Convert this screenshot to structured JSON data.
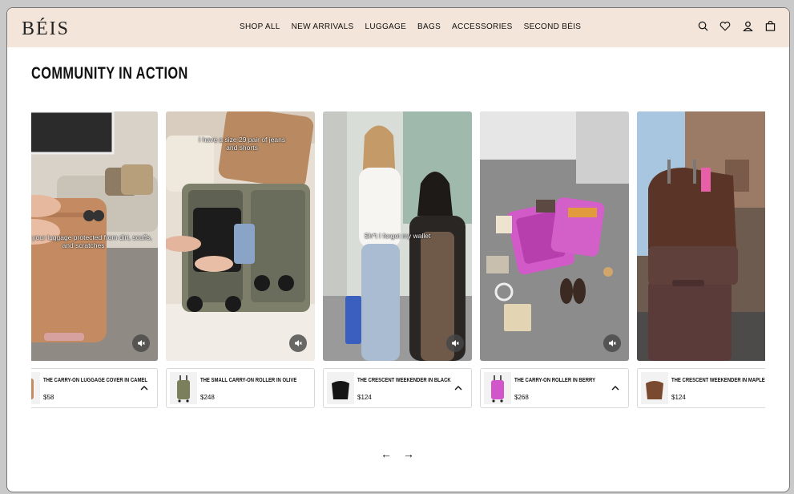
{
  "header": {
    "logo": "BÉIS",
    "nav": [
      "SHOP ALL",
      "NEW ARRIVALS",
      "LUGGAGE",
      "BAGS",
      "ACCESSORIES",
      "SECOND BÉIS"
    ],
    "icons": [
      "search-icon",
      "heart-icon",
      "account-icon",
      "cart-icon"
    ]
  },
  "section": {
    "title": "COMMUNITY IN ACTION"
  },
  "cards": [
    {
      "caption": "Keep your luggage protected from dirt, scuffs, and scratches",
      "product": "THE CARRY-ON LUGGAGE COVER IN CAMEL",
      "price": "$58",
      "color": "#c48b62"
    },
    {
      "caption": "I have a size 29 pair of jeans and shorts",
      "product": "THE SMALL CARRY-ON ROLLER IN OLIVE",
      "price": "$248",
      "color": "#7b7f5c"
    },
    {
      "caption": "Sh*t I forgot my wallet",
      "product": "THE CRESCENT WEEKENDER IN BLACK",
      "price": "$124",
      "color": "#151515"
    },
    {
      "caption": "",
      "product": "THE CARRY-ON ROLLER IN BERRY",
      "price": "$268",
      "color": "#d156c9"
    },
    {
      "caption": "",
      "product": "THE CRESCENT WEEKENDER IN MAPLE",
      "price": "$124",
      "color": "#7a4a30"
    }
  ],
  "controls": {
    "prev": "←",
    "next": "→"
  }
}
